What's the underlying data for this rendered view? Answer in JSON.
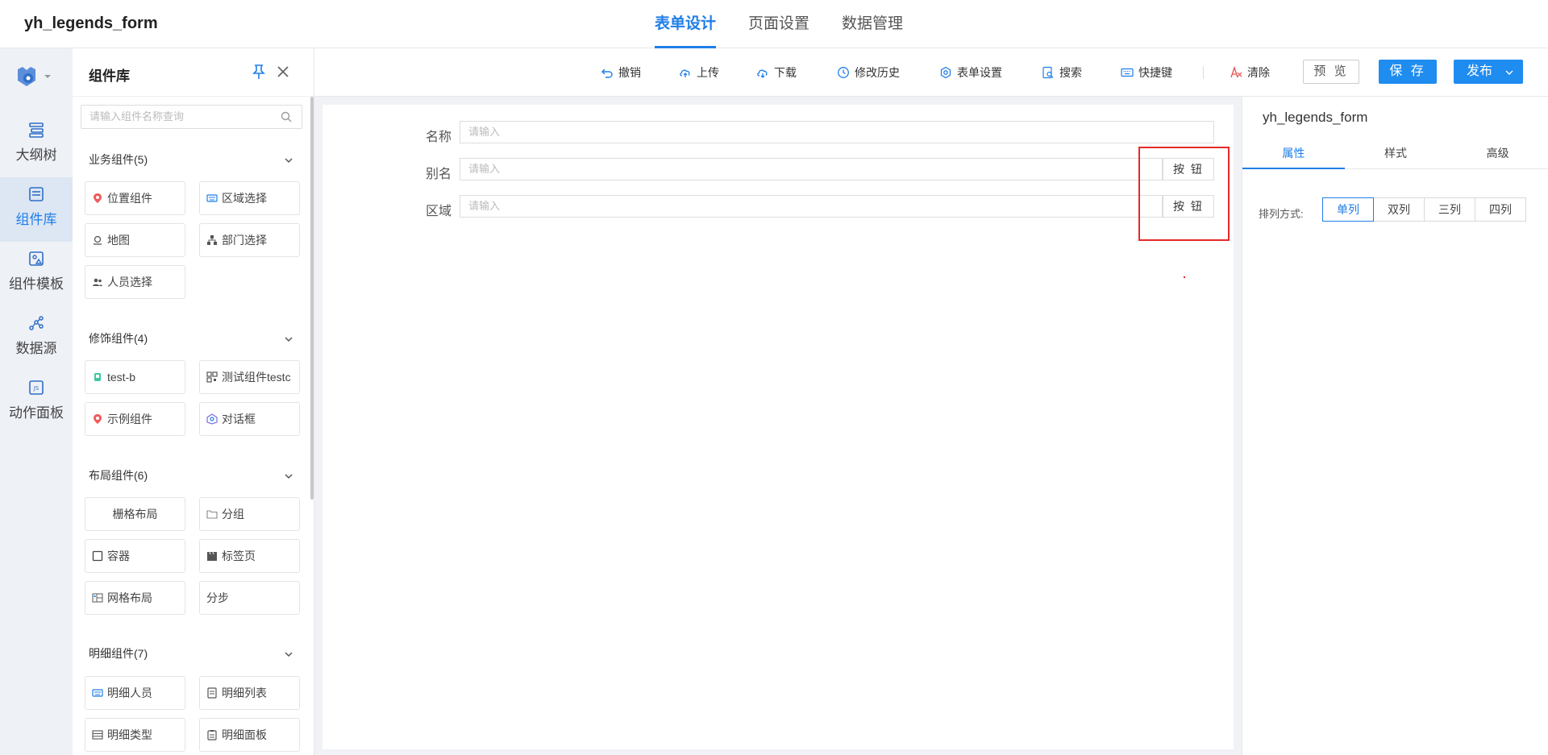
{
  "app": {
    "title": "yh_legends_form"
  },
  "main_tabs": [
    {
      "label": "表单设计",
      "active": true
    },
    {
      "label": "页面设置",
      "active": false
    },
    {
      "label": "数据管理",
      "active": false
    }
  ],
  "rail": {
    "items": [
      {
        "label": "大纲树",
        "icon": "outline-tree-icon",
        "active": false
      },
      {
        "label": "组件库",
        "icon": "component-library-icon",
        "active": true
      },
      {
        "label": "组件模板",
        "icon": "component-template-icon",
        "active": false
      },
      {
        "label": "数据源",
        "icon": "data-source-icon",
        "active": false
      },
      {
        "label": "动作面板",
        "icon": "action-panel-icon",
        "active": false
      }
    ]
  },
  "library": {
    "title": "组件库",
    "search_placeholder": "请输入组件名称查询",
    "groups": [
      {
        "title": "业务组件(5)",
        "items": [
          "位置组件",
          "区域选择",
          "地图",
          "部门选择",
          "人员选择"
        ]
      },
      {
        "title": "修饰组件(4)",
        "items": [
          "test-b",
          "测试组件testc",
          "示例组件",
          "对话框"
        ]
      },
      {
        "title": "布局组件(6)",
        "items": [
          "栅格布局",
          "分组",
          "容器",
          "标签页",
          "网格布局",
          "分步"
        ]
      },
      {
        "title": "明细组件(7)",
        "items": [
          "明细人员",
          "明细列表",
          "明细类型",
          "明细面板"
        ]
      }
    ]
  },
  "toolbar": {
    "undo": "撤销",
    "upload": "上传",
    "download": "下载",
    "history": "修改历史",
    "form_settings": "表单设置",
    "search": "搜索",
    "shortcuts": "快捷键",
    "clear": "清除",
    "preview": "预 览",
    "save": "保 存",
    "publish": "发布"
  },
  "form": {
    "fields": [
      {
        "label": "名称",
        "placeholder": "请输入",
        "has_button": false
      },
      {
        "label": "别名",
        "placeholder": "请输入",
        "has_button": true,
        "button_label": "按 钮"
      },
      {
        "label": "区域",
        "placeholder": "请输入",
        "has_button": true,
        "button_label": "按 钮"
      }
    ]
  },
  "props": {
    "title": "yh_legends_form",
    "tabs": [
      {
        "label": "属性",
        "active": true
      },
      {
        "label": "样式",
        "active": false
      },
      {
        "label": "高级",
        "active": false
      }
    ],
    "layout_label": "排列方式:",
    "layout_options": [
      {
        "label": "单列",
        "active": true
      },
      {
        "label": "双列",
        "active": false
      },
      {
        "label": "三列",
        "active": false
      },
      {
        "label": "四列",
        "active": false
      }
    ]
  },
  "colors": {
    "accent": "#1f7ee8",
    "highlight": "#e52a2a"
  }
}
